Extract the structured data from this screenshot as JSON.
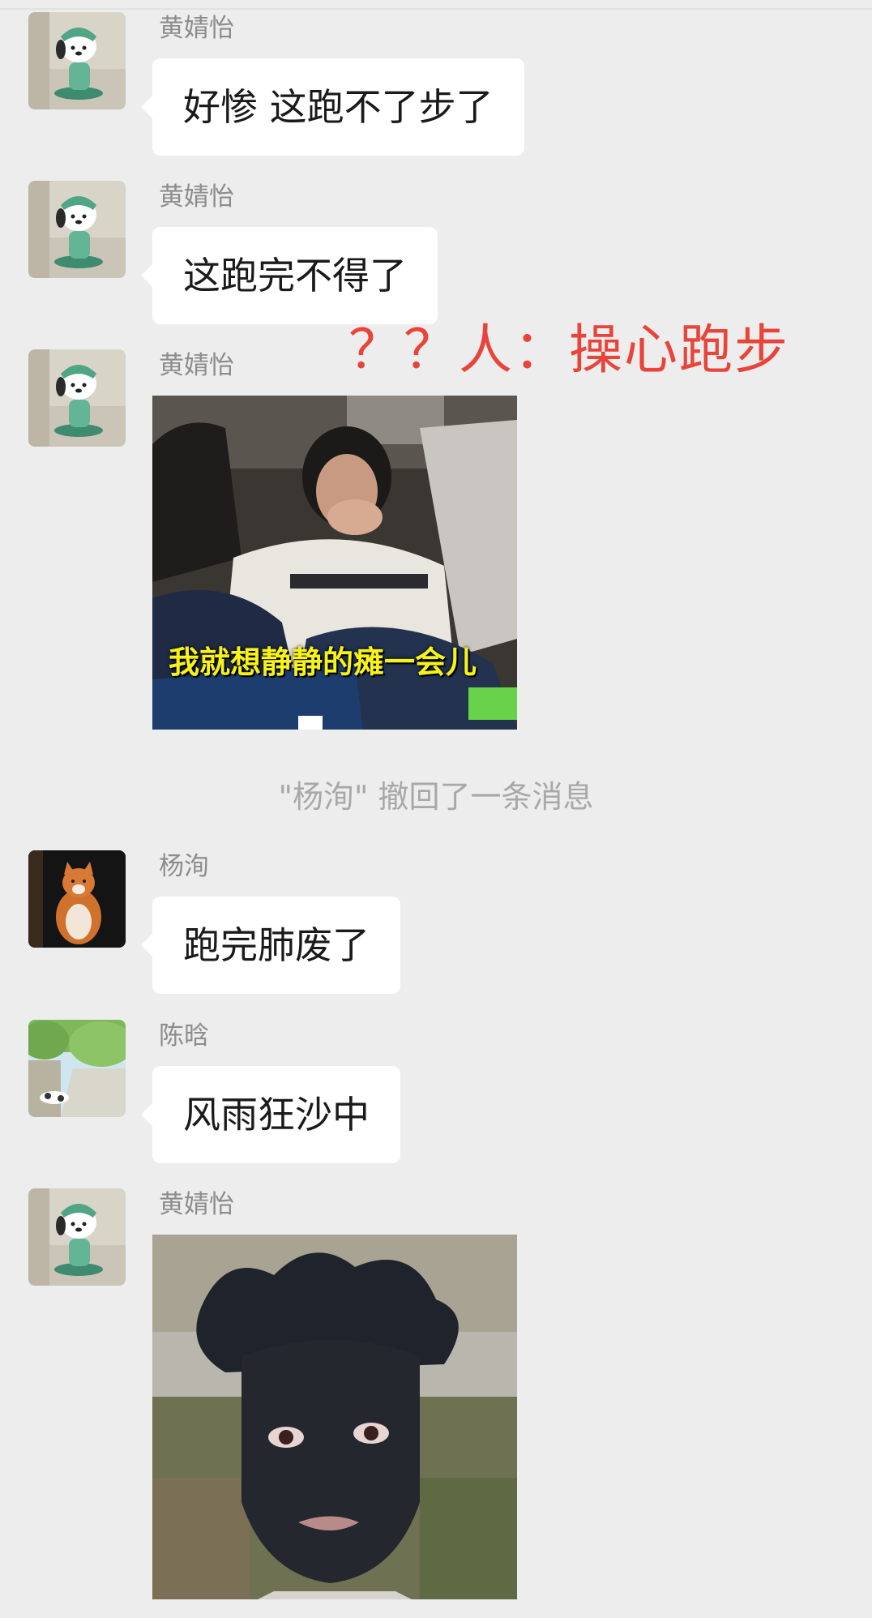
{
  "messages": [
    {
      "sender": "黄婧怡",
      "type": "text",
      "text": "好惨 这跑不了步了"
    },
    {
      "sender": "黄婧怡",
      "type": "text",
      "text": "这跑完不得了"
    },
    {
      "sender": "黄婧怡",
      "type": "image",
      "caption": "我就想静静的瘫一会儿"
    },
    {
      "type": "system",
      "text": "\"杨洵\" 撤回了一条消息"
    },
    {
      "sender": "杨洵",
      "type": "text",
      "text": "跑完肺废了"
    },
    {
      "sender": "陈晗",
      "type": "text",
      "text": "风雨狂沙中"
    },
    {
      "sender": "黄婧怡",
      "type": "image"
    }
  ],
  "annotation": {
    "text": "？？人：操心跑步",
    "color": "#e8443a"
  },
  "colors": {
    "background": "#ededed",
    "bubble": "#ffffff",
    "sender_name": "#8c8c8c",
    "system_text": "#a8a8a8"
  }
}
